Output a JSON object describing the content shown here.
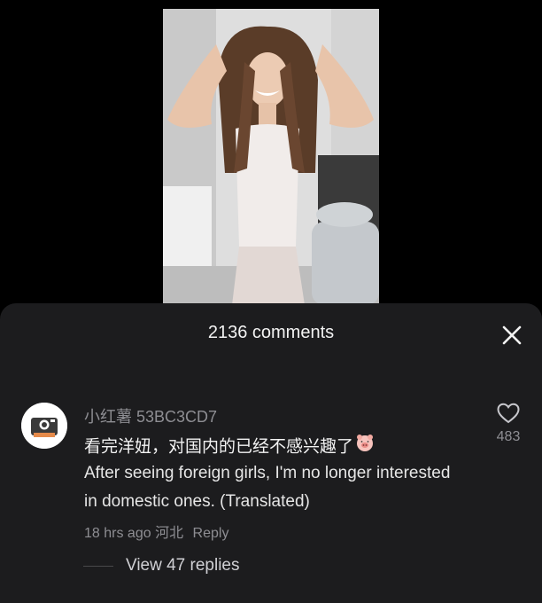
{
  "video": {
    "description_icon": "video-thumbnail"
  },
  "comments_panel": {
    "title": "2136 comments",
    "close_icon": "close-icon"
  },
  "comment": {
    "username": "小红薯 53BC3CD7",
    "text": "看完洋妞，对国内的已经不感兴趣了",
    "emoji_icon": "pig-face-emoji-icon",
    "translated_text": "After seeing foreign girls, I'm no longer interested in domestic ones. (Translated)",
    "timestamp": "18 hrs ago",
    "location": "河北",
    "reply_label": "Reply",
    "like_icon": "heart-icon",
    "like_count": "483",
    "view_replies": "View 47 replies"
  },
  "colors": {
    "sheet_bg": "#1c1c1e",
    "page_bg": "#000000",
    "muted_text": "#8e8e93",
    "primary_text": "#f2f2f2"
  }
}
